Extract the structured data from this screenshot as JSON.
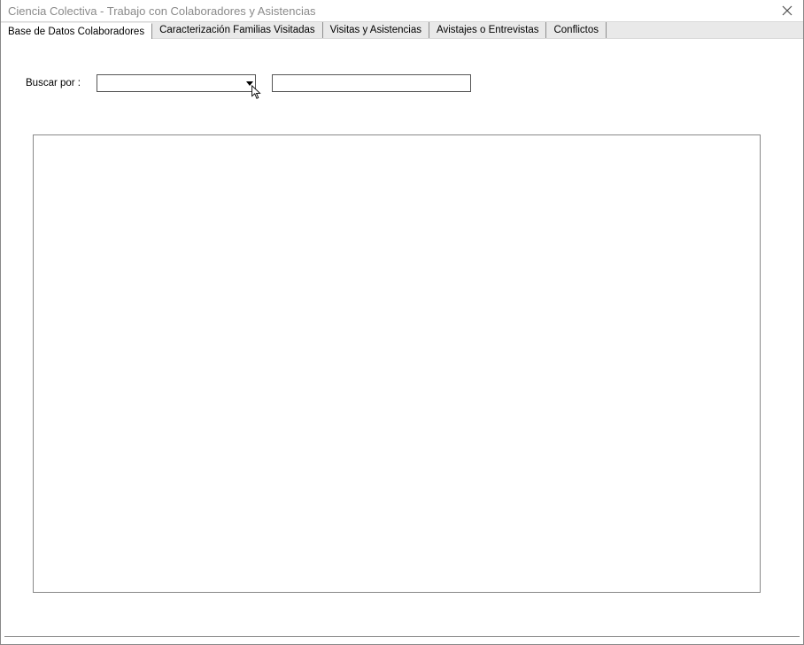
{
  "window": {
    "title": "Ciencia Colectiva - Trabajo con Colaboradores y Asistencias"
  },
  "tabs": [
    {
      "label": "Base de Datos Colaboradores",
      "active": true
    },
    {
      "label": "Caracterización Familias Visitadas",
      "active": false
    },
    {
      "label": "Visitas y Asistencias",
      "active": false
    },
    {
      "label": "Avistajes o Entrevistas",
      "active": false
    },
    {
      "label": "Conflictos",
      "active": false
    }
  ],
  "search": {
    "label": "Buscar por :",
    "combo_value": "",
    "text_value": ""
  }
}
